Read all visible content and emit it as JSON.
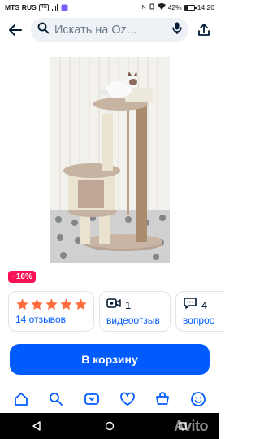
{
  "status_bar": {
    "carrier": "MTS RUS",
    "network_badge": "VoLTE",
    "battery_text": "42%",
    "battery_level_pct": 42,
    "time": "14:20"
  },
  "search": {
    "placeholder": "Искать на Oz..."
  },
  "product": {
    "discount": "−16%"
  },
  "reviews": {
    "stars": 5,
    "star_color": "#ff6c3e",
    "reviews_count": "14 отзывов",
    "video_count": "1",
    "video_label": "видеоотзыв",
    "questions_count": "4",
    "questions_label": "вопрос"
  },
  "cart": {
    "button_label": "В корзину",
    "accent_color": "#005bff"
  },
  "bottom_nav": {
    "items": [
      "home-icon",
      "catalog-icon",
      "ozon-icon",
      "favorites-icon",
      "cart-icon",
      "profile-icon"
    ]
  },
  "watermark": "Avito"
}
